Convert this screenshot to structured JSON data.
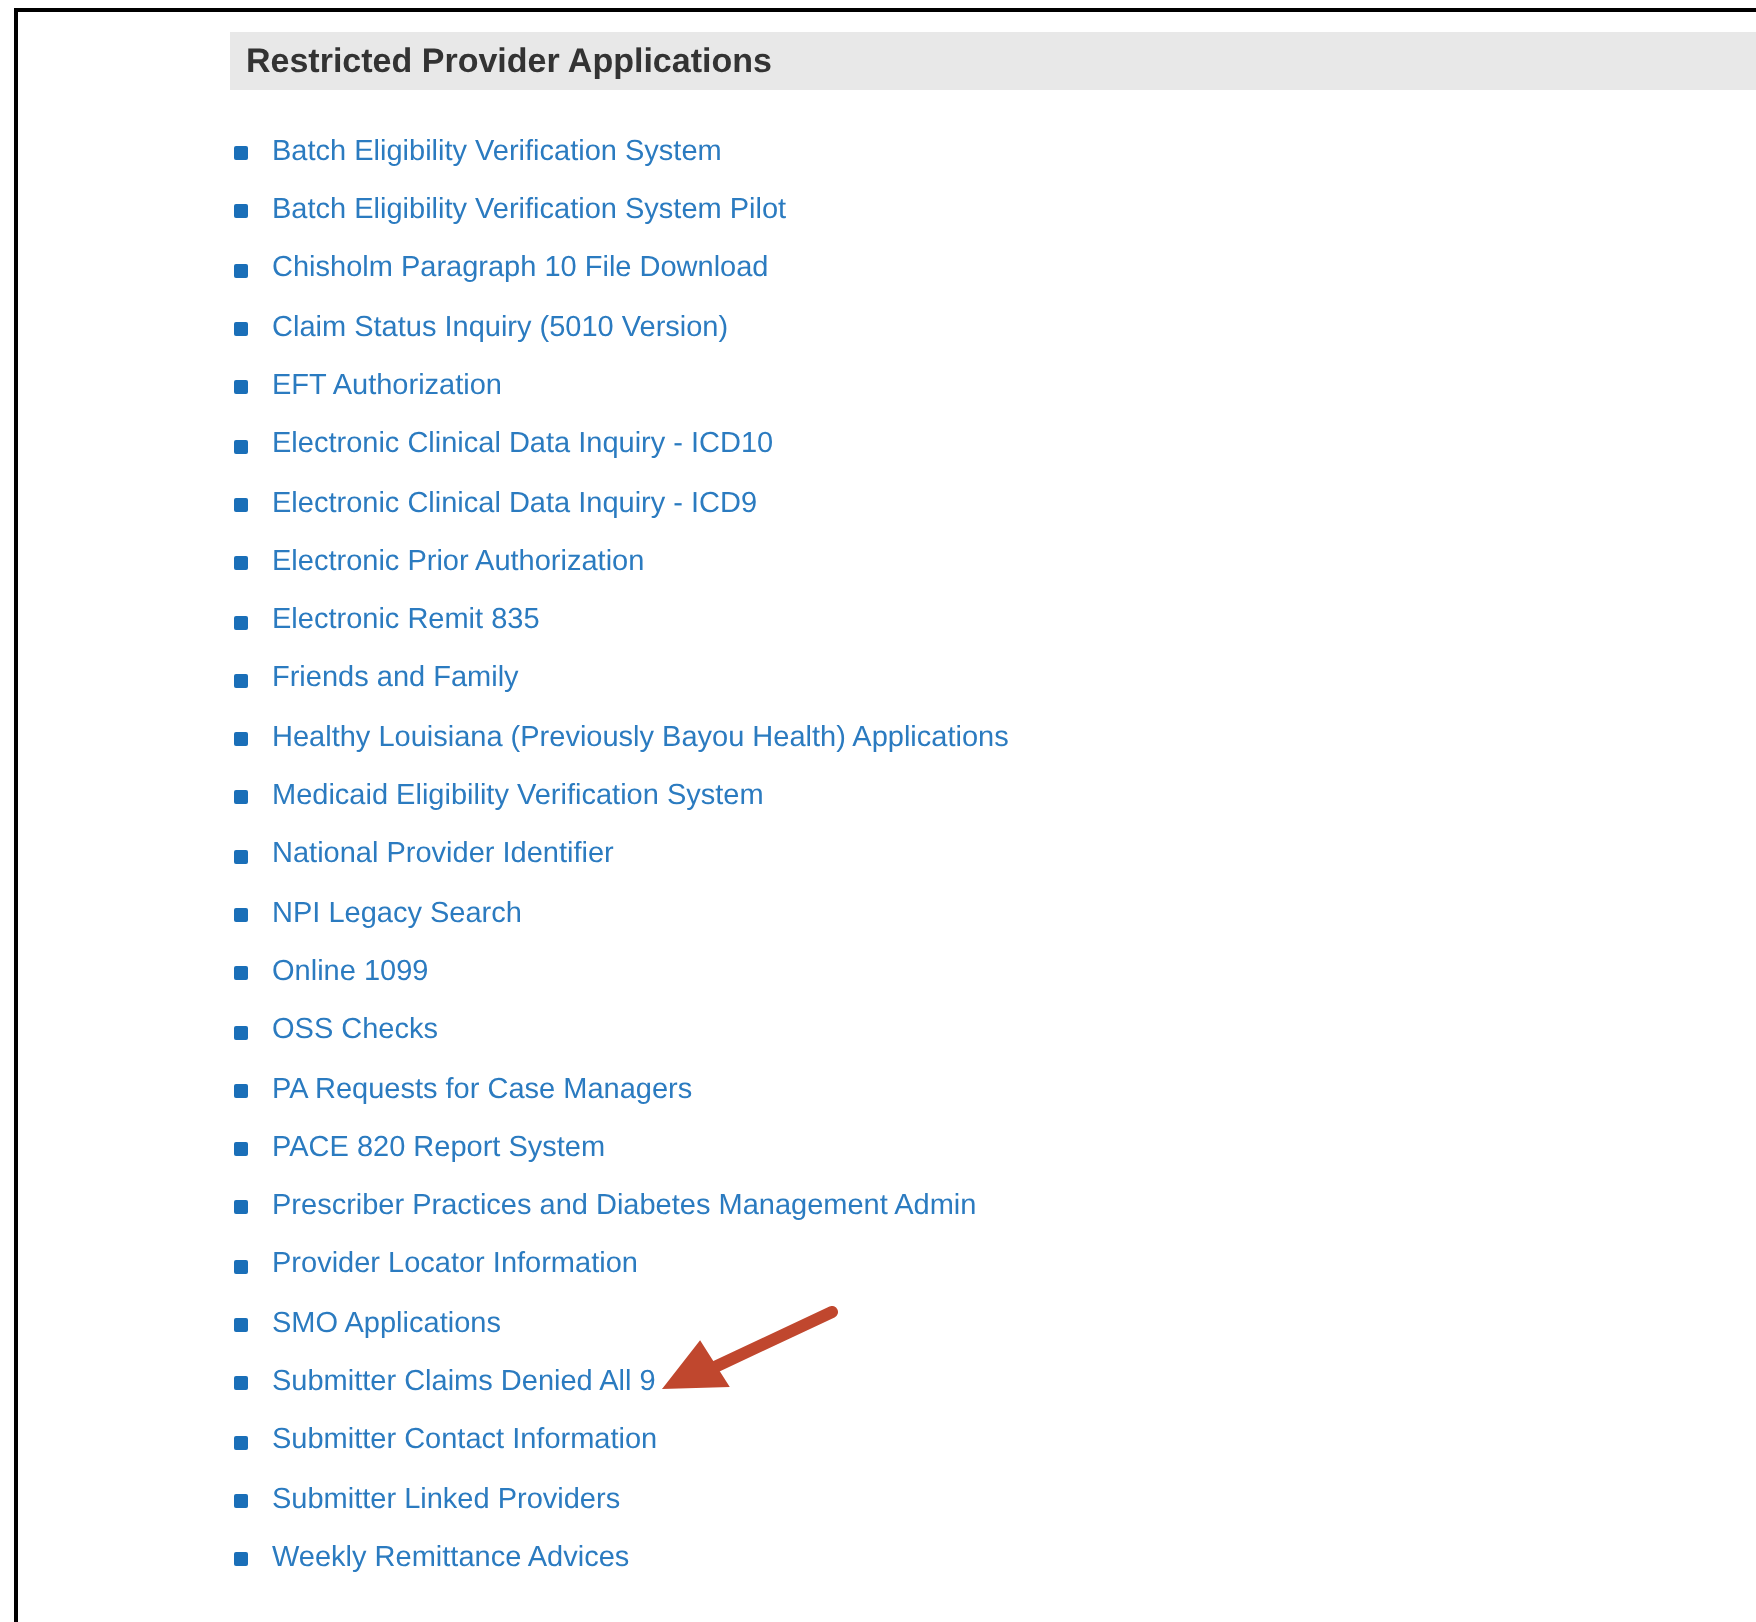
{
  "section": {
    "title": "Restricted Provider Applications"
  },
  "links": [
    {
      "label": "Batch Eligibility Verification System",
      "marked": false
    },
    {
      "label": "Batch Eligibility Verification System Pilot",
      "marked": false
    },
    {
      "label": "Chisholm Paragraph 10 File Download",
      "marked": false
    },
    {
      "label": "Claim Status Inquiry (5010 Version)",
      "marked": false
    },
    {
      "label": "EFT Authorization",
      "marked": false
    },
    {
      "label": "Electronic Clinical Data Inquiry - ICD10",
      "marked": false
    },
    {
      "label": "Electronic Clinical Data Inquiry - ICD9",
      "marked": false
    },
    {
      "label": "Electronic Prior Authorization",
      "marked": false
    },
    {
      "label": "Electronic Remit 835",
      "marked": false
    },
    {
      "label": "Friends and Family",
      "marked": false
    },
    {
      "label": "Healthy Louisiana (Previously Bayou Health) Applications",
      "marked": false
    },
    {
      "label": "Medicaid Eligibility Verification System",
      "marked": false
    },
    {
      "label": "National Provider Identifier",
      "marked": false
    },
    {
      "label": "NPI Legacy Search",
      "marked": false
    },
    {
      "label": "Online 1099",
      "marked": false
    },
    {
      "label": "OSS Checks",
      "marked": false
    },
    {
      "label": "PA Requests for Case Managers",
      "marked": false
    },
    {
      "label": "PACE 820 Report System",
      "marked": false
    },
    {
      "label": "Prescriber Practices and Diabetes Management Admin",
      "marked": false
    },
    {
      "label": "Provider Locator Information",
      "marked": false
    },
    {
      "label": "SMO Applications",
      "marked": false
    },
    {
      "label": "Submitter Claims Denied All 9",
      "marked": true
    },
    {
      "label": "Submitter Contact Information",
      "marked": false
    },
    {
      "label": "Submitter Linked Providers",
      "marked": false
    },
    {
      "label": "Weekly Remittance Advices",
      "marked": false
    }
  ]
}
